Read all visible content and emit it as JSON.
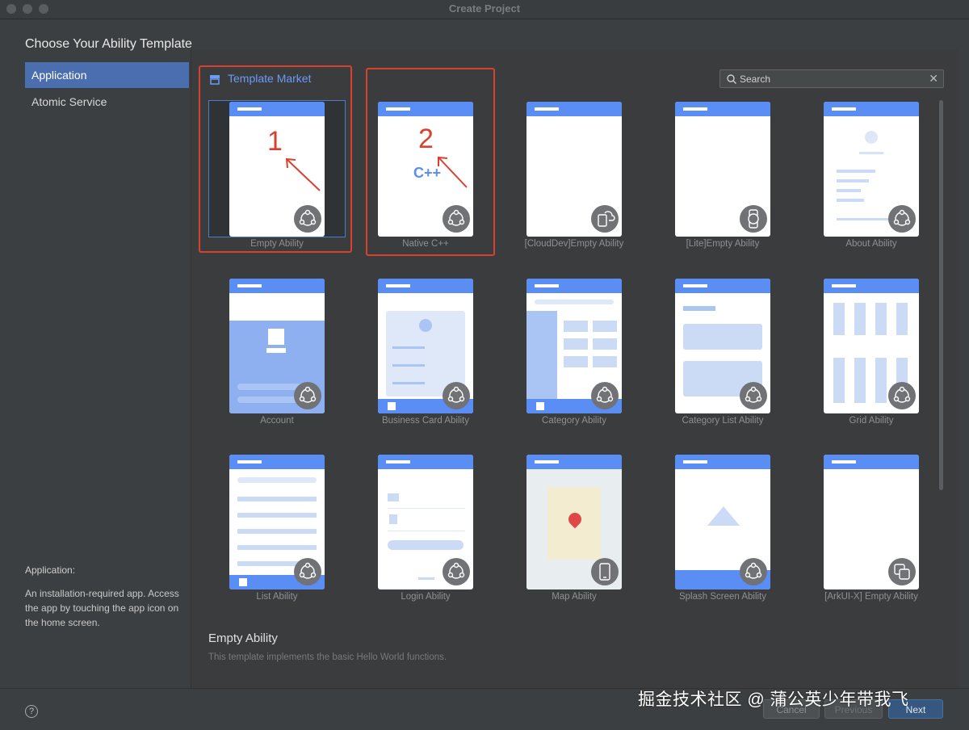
{
  "window": {
    "title": "Create Project"
  },
  "heading": "Choose Your Ability Template",
  "sidebar": {
    "items": [
      {
        "label": "Application",
        "selected": true
      },
      {
        "label": "Atomic Service",
        "selected": false
      }
    ],
    "description_title": "Application:",
    "description": "An installation-required app. Access the app by touching the app icon on the home screen."
  },
  "market": {
    "label": "Template Market",
    "icon": "store-icon"
  },
  "search": {
    "placeholder": "Search",
    "value": ""
  },
  "templates": [
    {
      "label": "Empty Ability",
      "badge_icon": "ability-icon",
      "selected": true
    },
    {
      "label": "Native C++",
      "badge_icon": "ability-icon",
      "center_icon": "C++"
    },
    {
      "label": "[CloudDev]Empty Ability",
      "badge_icon": "cloud-dev-icon"
    },
    {
      "label": "[Lite]Empty Ability",
      "badge_icon": "watch-icon"
    },
    {
      "label": "About Ability",
      "badge_icon": "ability-icon"
    },
    {
      "label": "Account",
      "badge_icon": "ability-icon"
    },
    {
      "label": "Business Card Ability",
      "badge_icon": "ability-icon"
    },
    {
      "label": "Category Ability",
      "badge_icon": "ability-icon"
    },
    {
      "label": "Category List Ability",
      "badge_icon": "ability-icon"
    },
    {
      "label": "Grid Ability",
      "badge_icon": "ability-icon"
    },
    {
      "label": "List Ability",
      "badge_icon": "ability-icon"
    },
    {
      "label": "Login Ability",
      "badge_icon": "ability-icon"
    },
    {
      "label": "Map Ability",
      "badge_icon": "phone-icon"
    },
    {
      "label": "Splash Screen Ability",
      "badge_icon": "ability-icon"
    },
    {
      "label": "[ArkUI-X] Empty Ability",
      "badge_icon": "cross-platform-icon"
    }
  ],
  "annotations": {
    "first": "1",
    "second": "2",
    "color": "#d9412e"
  },
  "detail": {
    "title": "Empty Ability",
    "text": "This template implements the basic Hello World functions."
  },
  "buttons": {
    "cancel": "Cancel",
    "previous": "Previous",
    "next": "Next"
  },
  "help_label": "?",
  "watermark": "掘金技术社区 @ 蒲公英少年带我飞",
  "colors": {
    "accent": "#4b6eaf",
    "template_header": "#5a8ef5",
    "link": "#6b9bf5"
  }
}
